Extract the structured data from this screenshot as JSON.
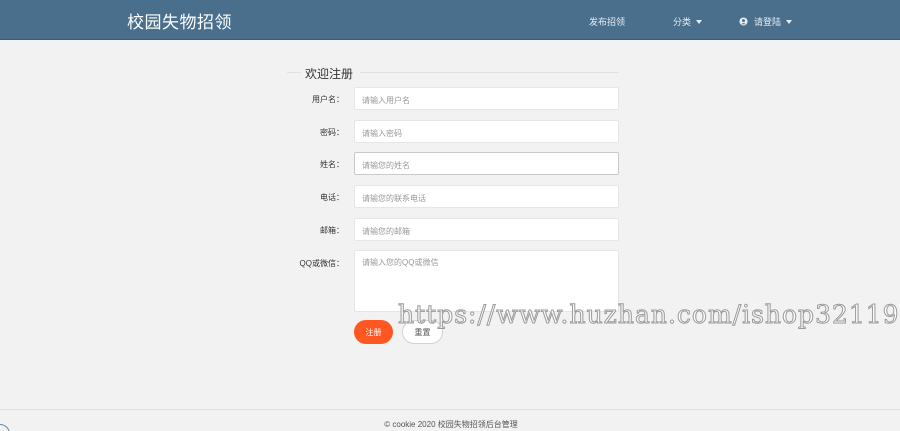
{
  "header": {
    "brand": "校园失物招领",
    "nav_publish": "发布招领",
    "nav_category": "分类",
    "nav_login": "请登陆"
  },
  "form": {
    "legend": "欢迎注册",
    "fields": [
      {
        "label": "用户名：",
        "placeholder": "请输入用户名"
      },
      {
        "label": "密码：",
        "placeholder": "请输入密码"
      },
      {
        "label": "姓名：",
        "placeholder": "请输您的姓名"
      },
      {
        "label": "电话：",
        "placeholder": "请输您的联系电话"
      },
      {
        "label": "邮箱：",
        "placeholder": "请输您的邮箱"
      },
      {
        "label": "QQ或微信：",
        "placeholder": "请输入您的QQ或微信"
      }
    ],
    "submit_label": "注册",
    "reset_label": "重置"
  },
  "watermark": "https://www.huzhan.com/ishop32119",
  "footer": {
    "text": "© cookie 2020  校园失物招领后台管理"
  },
  "colors": {
    "header_bg": "#4a6f8d",
    "submit_bg": "#ff5722",
    "page_bg": "#f2f2f2"
  }
}
